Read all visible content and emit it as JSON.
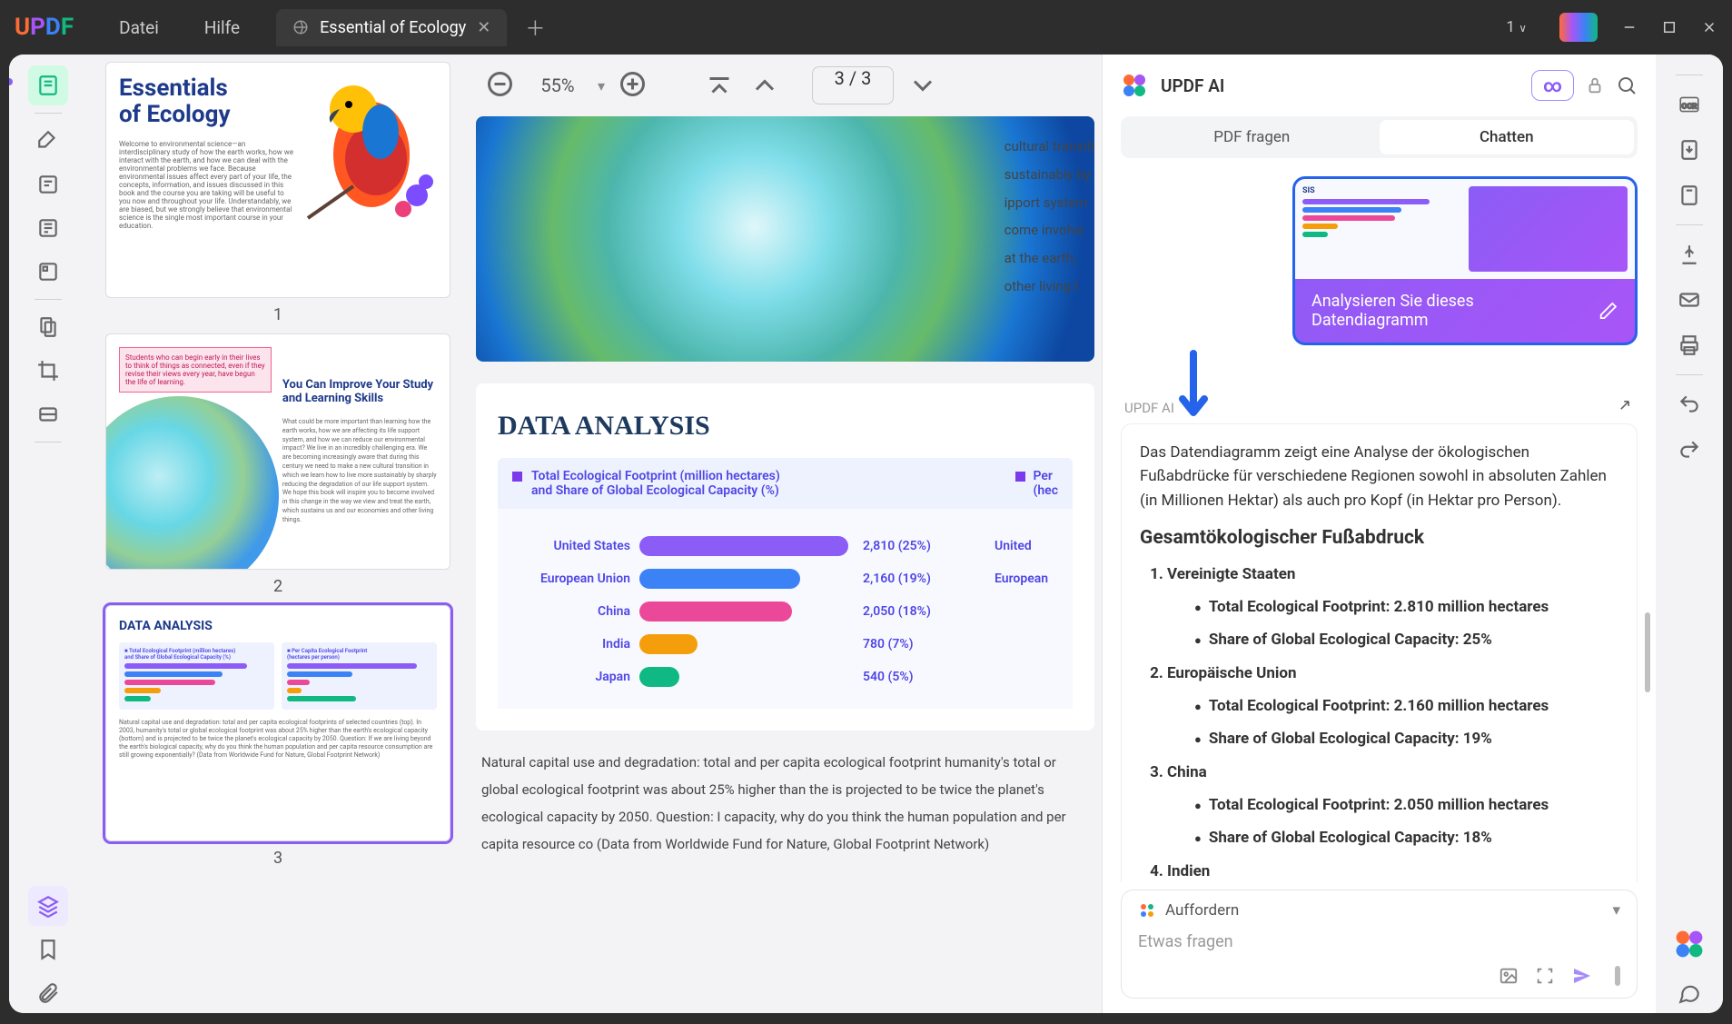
{
  "app": {
    "name": "UPDF"
  },
  "menu": {
    "file": "Datei",
    "help": "Hilfe"
  },
  "tab": {
    "title": "Essential of Ecology"
  },
  "window": {
    "count_indicator": "1"
  },
  "toolbar": {
    "zoom": "55%",
    "page_current": "3",
    "page_sep": "/",
    "page_total": "3"
  },
  "thumbs": {
    "nums": [
      "1",
      "2",
      "3"
    ]
  },
  "thumb1": {
    "title1": "Essentials",
    "title2": "of Ecology",
    "body": "Welcome to environmental science—an interdisciplinary study of how the earth works, how we interact with the earth, and how we can deal with the environmental problems we face. Because environmental issues affect every part of your life, the concepts, information, and issues discussed in this book and the course you are taking will be useful to you now and throughout your life. Understandably, we are biased, but we strongly believe that environmental science is the single most important course in your education."
  },
  "thumb2": {
    "pinkbox": "Students who can begin early in their lives to think of things as connected, even if they revise their views every year, have begun the life of learning.",
    "title": "You Can Improve Your Study and Learning Skills",
    "body": "What could be more important than learning how the earth works, how we are affecting its life support system, and how we can reduce our environmental impact? We live in an incredibly challenging era. We are becoming increasingly aware that during this century we need to make a new cultural transition in which we learn how to live more sustainably by sharply reducing the degradation of our life support system. We hope this book will inspire you to become involved in this change in the way we view and treat the earth, which sustains us and our economies and other living things."
  },
  "thumb3": {
    "title": "DATA ANALYSIS",
    "note": "Natural capital use and degradation: total and per capita ecological footprints of selected countries (top). In 2003, humanity's total or global ecological footprint was about 25% higher than the earth's ecological capacity (bottom) and is projected to be twice the planet's ecological capacity by 2050. Question: If we are living beyond the earth's biological capacity, why do you think the human population and per capita resource consumption are still growing exponentially? (Data from Worldwide Fund for Nature, Global Footprint Network)"
  },
  "page_globe_text": [
    "cultural transiti",
    "sustainably by",
    "ipport system",
    "come involve",
    "at the earth,",
    "other living t"
  ],
  "data_analysis": {
    "title": "DATA ANALYSIS",
    "legend_line1": "Total Ecological Footprint (million hectares)",
    "legend_line2": "and Share of Global Ecological Capacity (%)",
    "right_header1": "Per",
    "right_header2": "(hec",
    "right_labels": [
      "United",
      "European"
    ]
  },
  "chart_data": {
    "type": "bar",
    "categories": [
      "United States",
      "European Union",
      "China",
      "India",
      "Japan"
    ],
    "values": [
      2810,
      2160,
      2050,
      780,
      540
    ],
    "shares_pct": [
      25,
      19,
      18,
      7,
      5
    ],
    "value_labels": [
      "2,810 (25%)",
      "2,160 (19%)",
      "2,050 (18%)",
      "780 (7%)",
      "540 (5%)"
    ],
    "colors": [
      "#8b5cf6",
      "#3b82f6",
      "#ec4899",
      "#f59e0b",
      "#10b981"
    ],
    "width_pct": [
      100,
      77,
      73,
      28,
      19
    ],
    "title": "Total Ecological Footprint (million hectares) and Share of Global Ecological Capacity (%)",
    "xlabel": "",
    "ylabel": "",
    "ylim": [
      0,
      2810
    ]
  },
  "body_paragraph": "Natural capital use and degradation: total and per capita ecological footprint humanity's total or global ecological footprint was about 25% higher than the is projected to be twice the planet's ecological capacity by 2050. Question: I capacity, why do you think the human population and per capita resource co (Data from Worldwide Fund for Nature, Global Footprint Network)",
  "ai": {
    "title": "UPDF AI",
    "tab1": "PDF fragen",
    "tab2": "Chatten",
    "user_msg": "Analysieren Sie dieses Datendiagramm",
    "label": "UPDF AI",
    "response_intro": "Das Datendiagramm zeigt eine Analyse der ökologischen Fußabdrücke für verschiedene Regionen sowohl in absoluten Zahlen (in Millionen Hektar) als auch pro Kopf (in Hektar pro Person).",
    "response_h1": "Gesamtökologischer Fußabdruck",
    "items": [
      {
        "name": "Vereinigte Staaten",
        "l1": "Total Ecological Footprint: 2.810 million hectares",
        "l2": "Share of Global Ecological Capacity: 25%"
      },
      {
        "name": "Europäische Union",
        "l1": "Total Ecological Footprint: 2.160 million hectares",
        "l2": "Share of Global Ecological Capacity: 19%"
      },
      {
        "name": "China",
        "l1": "Total Ecological Footprint: 2.050 million hectares",
        "l2": "Share of Global Ecological Capacity: 18%"
      },
      {
        "name": "Indien",
        "l1": "",
        "l2": ""
      }
    ],
    "thumb_title": "SIS",
    "prompt_label": "Auffordern",
    "placeholder": "Etwas fragen"
  }
}
